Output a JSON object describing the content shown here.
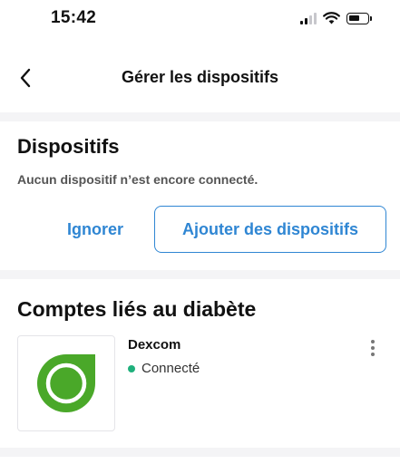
{
  "status_bar": {
    "time": "15:42",
    "icons": [
      "signal-icon",
      "wifi-icon",
      "battery-icon"
    ]
  },
  "nav": {
    "title": "Gérer les dispositifs",
    "back_icon": "chevron-left-icon"
  },
  "devices": {
    "title": "Dispositifs",
    "empty_message": "Aucun dispositif n’est encore connecté.",
    "ignore_label": "Ignorer",
    "add_label": "Ajouter des dispositifs"
  },
  "accounts": {
    "title": "Comptes liés au diabète",
    "items": [
      {
        "name": "Dexcom",
        "status": "Connecté",
        "logo_icon": "dexcom-logo-icon",
        "menu_icon": "more-vertical-icon"
      }
    ]
  },
  "colors": {
    "accent": "#2f86d3",
    "status_connected": "#1fb07c",
    "dexcom_green": "#4aa829",
    "background": "#f4f4f6"
  }
}
